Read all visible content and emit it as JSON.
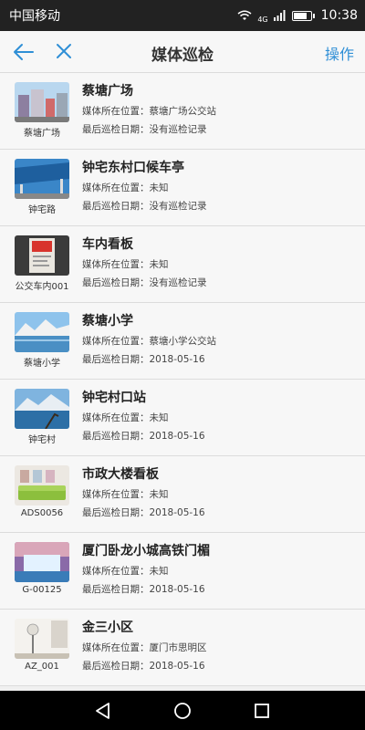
{
  "status_bar": {
    "carrier": "中国移动",
    "network": "4G",
    "time": "10:38",
    "battery_level": 0.85
  },
  "nav": {
    "title": "媒体巡检",
    "action_label": "操作"
  },
  "labels": {
    "location_prefix": "媒体所在位置：",
    "date_prefix": "最后巡检日期："
  },
  "items": [
    {
      "name": "蔡塘广场",
      "caption": "蔡塘广场",
      "location": "蔡塘广场公交站",
      "last_check": "没有巡检记录"
    },
    {
      "name": "钟宅东村口候车亭",
      "caption": "钟宅路",
      "location": "未知",
      "last_check": "没有巡检记录"
    },
    {
      "name": "车内看板",
      "caption": "公交车内001",
      "location": "未知",
      "last_check": "没有巡检记录"
    },
    {
      "name": "蔡塘小学",
      "caption": "蔡塘小学",
      "location": "蔡塘小学公交站",
      "last_check": "2018-05-16"
    },
    {
      "name": "钟宅村口站",
      "caption": "钟宅村",
      "location": "未知",
      "last_check": "2018-05-16"
    },
    {
      "name": "市政大楼看板",
      "caption": "ADS0056",
      "location": "未知",
      "last_check": "2018-05-16"
    },
    {
      "name": "厦门卧龙小城高铁门楣",
      "caption": "G-00125",
      "location": "未知",
      "last_check": "2018-05-16"
    },
    {
      "name": "金三小区",
      "caption": "AZ_001",
      "location": "厦门市思明区",
      "last_check": "2018-05-16"
    }
  ],
  "icons": {
    "back": "back-arrow-icon",
    "close": "close-icon",
    "home": "home-icon",
    "recents": "recents-icon",
    "nav_back": "nav-back-icon"
  },
  "colors": {
    "accent": "#2f8fd6",
    "status_bar": "#222222",
    "system_nav": "#000000"
  }
}
